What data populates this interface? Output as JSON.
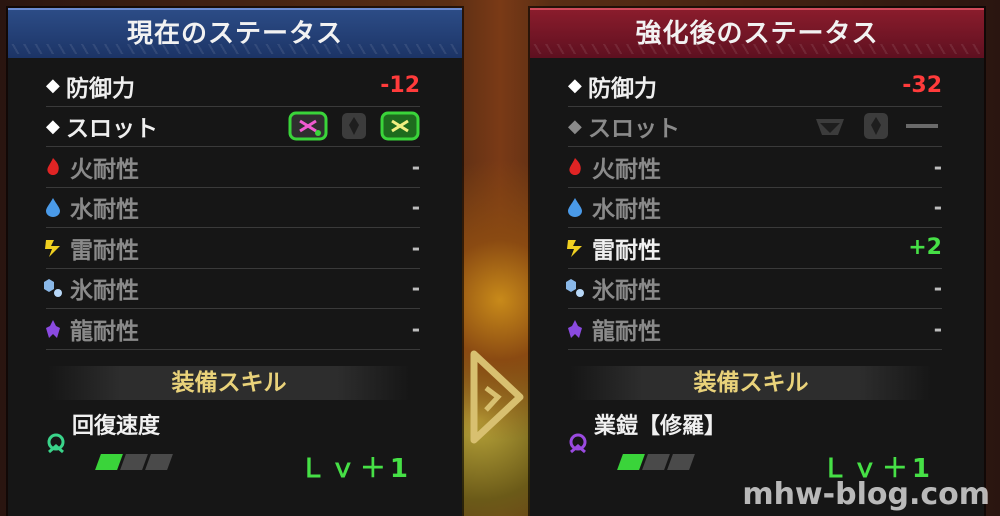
{
  "left": {
    "title": "現在のステータス",
    "rows": [
      {
        "label": "防御力",
        "value": "-12"
      },
      {
        "label": "スロット",
        "value": ""
      },
      {
        "label": "火耐性",
        "value": "-"
      },
      {
        "label": "水耐性",
        "value": "-"
      },
      {
        "label": "雷耐性",
        "value": "-"
      },
      {
        "label": "氷耐性",
        "value": "-"
      },
      {
        "label": "龍耐性",
        "value": "-"
      }
    ],
    "skill_header": "装備スキル",
    "skill": {
      "name": "回復速度",
      "level": "Ｌｖ＋1",
      "gauge_filled": 1,
      "gauge_total": 3
    }
  },
  "right": {
    "title": "強化後のステータス",
    "rows": [
      {
        "label": "防御力",
        "value": "-32"
      },
      {
        "label": "スロット",
        "value": ""
      },
      {
        "label": "火耐性",
        "value": "-"
      },
      {
        "label": "水耐性",
        "value": "-"
      },
      {
        "label": "雷耐性",
        "value": "+2"
      },
      {
        "label": "氷耐性",
        "value": "-"
      },
      {
        "label": "龍耐性",
        "value": "-"
      }
    ],
    "skill_header": "装備スキル",
    "skill": {
      "name": "業鎧【修羅】",
      "level": "Ｌｖ＋1",
      "gauge_filled": 1,
      "gauge_total": 3
    }
  },
  "watermark": "mhw-blog.com",
  "colors": {
    "negative": "#ff3b3b",
    "positive": "#46e046",
    "left_header": "#2c4c86",
    "right_header": "#8a1c2c"
  }
}
